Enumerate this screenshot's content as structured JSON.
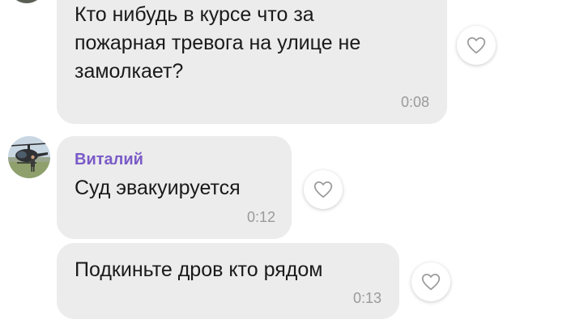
{
  "messages": [
    {
      "lines": [
        "Кто нибудь в курсе что за",
        "пожарная тревога на улице не",
        "замолкает?"
      ],
      "time": "0:08"
    },
    {
      "sender": "Виталий",
      "lines": [
        "Суд эвакуируется"
      ],
      "time": "0:12"
    },
    {
      "lines": [
        "Подкиньте дров кто рядом"
      ],
      "time": "0:13"
    }
  ],
  "colors": {
    "bubble": "#ececec",
    "sender_name": "#7a5bc7",
    "time": "#9a9a9a",
    "heart_outline": "#9a9a9a"
  },
  "icons": {
    "like": "heart-outline-icon",
    "avatar": "helicopter-photo-avatar"
  }
}
